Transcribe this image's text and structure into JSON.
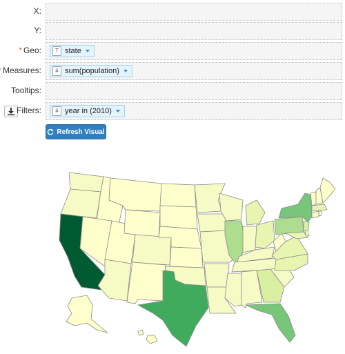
{
  "shelves": {
    "x": {
      "label": "X:"
    },
    "y": {
      "label": "Y:"
    },
    "geo": {
      "label": "Geo:",
      "required_mark": "*",
      "field_type": "T",
      "field": "state"
    },
    "measures": {
      "label": "Measures:",
      "required_mark": "*",
      "field_type": "#",
      "field": "sum(population)"
    },
    "tooltips": {
      "label": "Tooltips:"
    },
    "filters": {
      "label": "Filters:",
      "field_type": "#",
      "field": "year in (2010)"
    }
  },
  "refresh_button": {
    "label": "Refresh Visual",
    "icon": "refresh-icon"
  },
  "filters_icon": "download-icon",
  "map": {
    "type": "choropleth",
    "field": "state",
    "measure": "sum(population)",
    "filter": "year in (2010)",
    "palette": [
      "#ffffcc",
      "#f6fac5",
      "#e8f5b0",
      "#d9f0a3",
      "#addd8e",
      "#78c679",
      "#41ab5d",
      "#238443",
      "#005a32"
    ]
  }
}
